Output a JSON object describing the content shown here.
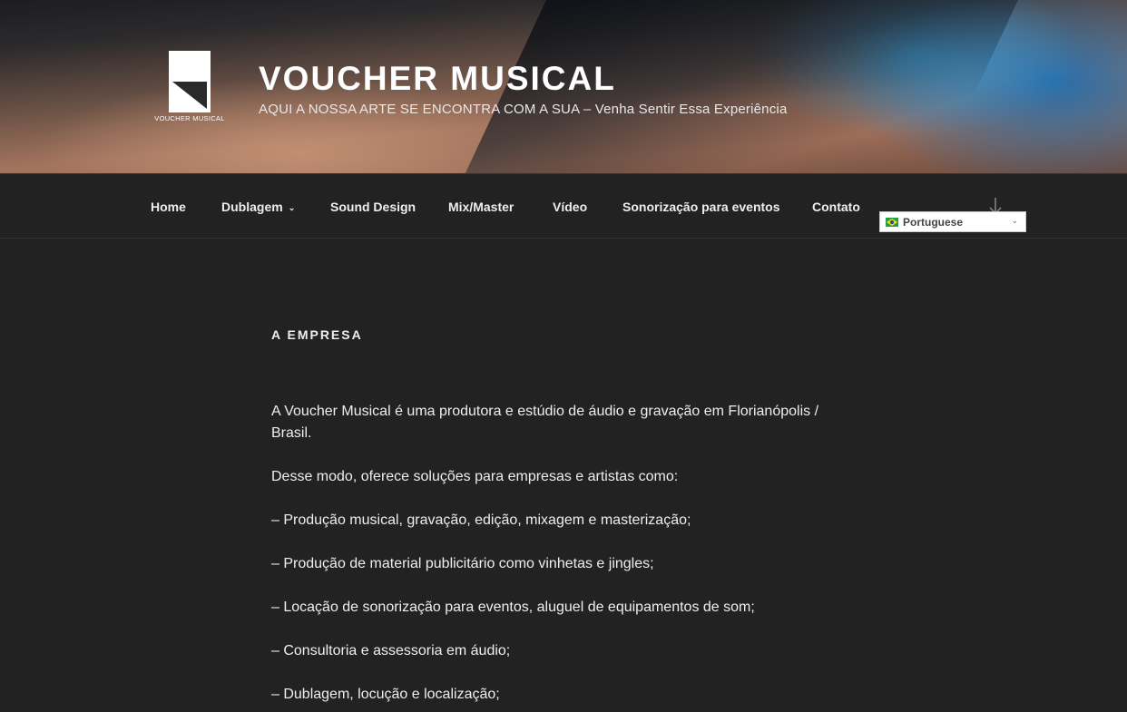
{
  "header": {
    "logo_text": "VOUCHER MUSICAL",
    "site_title": "VOUCHER MUSICAL",
    "site_description": "AQUI A NOSSA ARTE SE ENCONTRA COM A SUA – Venha Sentir Essa Experiência"
  },
  "nav": {
    "items": [
      {
        "label": "Home"
      },
      {
        "label": "Dublagem",
        "has_submenu": true
      },
      {
        "label": "Sound Design"
      },
      {
        "label": "Mix/Master"
      },
      {
        "label": "Vídeo"
      },
      {
        "label": "Sonorização para eventos"
      },
      {
        "label": "Contato"
      }
    ],
    "scroll_icon": "arrow-down-icon"
  },
  "language_selector": {
    "selected": "Portuguese",
    "flag_icon": "brazil-flag-icon"
  },
  "page": {
    "title": "A EMPRESA",
    "paragraphs": [
      "A Voucher Musical é uma produtora e estúdio de áudio e gravação em Florianópolis / Brasil.",
      "Desse modo, oferece soluções para empresas e artistas como:",
      "– Produção musical, gravação, edição, mixagem e masterização;",
      "– Produção de material publicitário como vinhetas e jingles;",
      "– Locação de sonorização para eventos, aluguel de equipamentos de som;",
      "– Consultoria e assessoria em áudio;",
      "– Dublagem, locução e localização;"
    ]
  },
  "colors": {
    "background": "#222222",
    "text": "#eeeeee",
    "header_accent": "#2a78b5"
  }
}
